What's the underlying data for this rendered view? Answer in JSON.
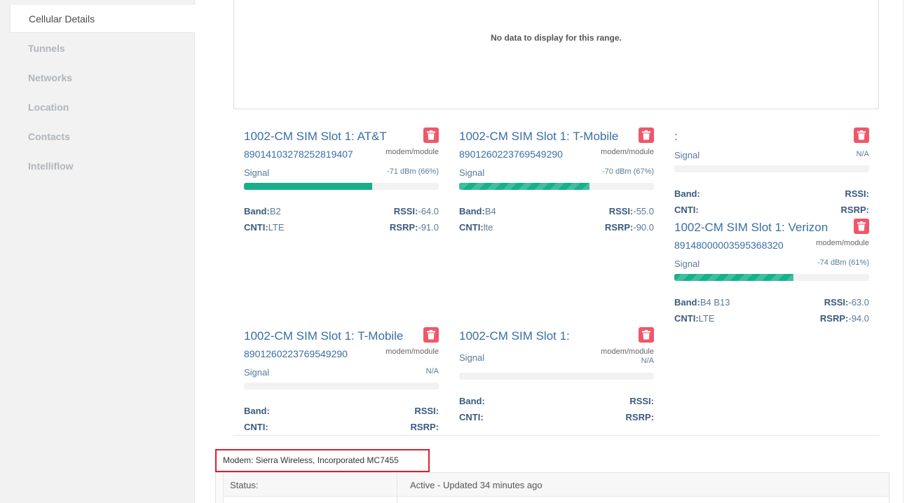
{
  "sidebar": {
    "items": [
      {
        "label": "Cellular Details"
      },
      {
        "label": "Tunnels"
      },
      {
        "label": "Networks"
      },
      {
        "label": "Location"
      },
      {
        "label": "Contacts"
      },
      {
        "label": "Intelliflow"
      }
    ]
  },
  "chart": {
    "empty_message": "No data to display for this range."
  },
  "cards": [
    {
      "title": "1002-CM SIM Slot 1: AT&T",
      "iccid": "89014103278252819407",
      "modem": "modem/module",
      "signal_label": "Signal",
      "signal_value": "-71 dBm (66%)",
      "signal_percent": 66,
      "band_label": "Band:",
      "band": "B2",
      "cnti_label": "CNTI:",
      "cnti": "LTE",
      "rssi_label": "RSSI:",
      "rssi": "-64.0",
      "rsrp_label": "RSRP:",
      "rsrp": "-91.0"
    },
    {
      "title": "1002-CM SIM Slot 1: T-Mobile",
      "iccid": "8901260223769549290",
      "modem": "modem/module",
      "signal_label": "Signal",
      "signal_value": "-70 dBm (67%)",
      "signal_percent": 67,
      "band_label": "Band:",
      "band": "B4",
      "cnti_label": "CNTI:",
      "cnti": "lte",
      "rssi_label": "RSSI:",
      "rssi": "-55.0",
      "rsrp_label": "RSRP:",
      "rsrp": "-90.0"
    },
    {
      "title": ":",
      "iccid": "",
      "modem": "",
      "signal_label": "Signal",
      "signal_value": "N/A",
      "signal_percent": 0,
      "band_label": "Band:",
      "band": "",
      "cnti_label": "CNTI:",
      "cnti": "",
      "rssi_label": "RSSI:",
      "rssi": "",
      "rsrp_label": "RSRP:",
      "rsrp": ""
    },
    {
      "title": "1002-CM SIM Slot 1: Verizon",
      "iccid": "89148000003595368320",
      "modem": "modem/module",
      "signal_label": "Signal",
      "signal_value": "-74 dBm (61%)",
      "signal_percent": 61,
      "band_label": "Band:",
      "band": "B4 B13",
      "cnti_label": "CNTI:",
      "cnti": "LTE",
      "rssi_label": "RSSI:",
      "rssi": "-63.0",
      "rsrp_label": "RSRP:",
      "rsrp": "-94.0"
    },
    {
      "title": "1002-CM SIM Slot 1: T-Mobile",
      "iccid": "8901260223769549290",
      "modem": "modem/module",
      "signal_label": "Signal",
      "signal_value": "N/A",
      "signal_percent": 0,
      "band_label": "Band:",
      "band": "",
      "cnti_label": "CNTI:",
      "cnti": "",
      "rssi_label": "RSSI:",
      "rssi": "",
      "rsrp_label": "RSRP:",
      "rsrp": ""
    },
    {
      "title": "1002-CM SIM Slot 1:",
      "iccid": "",
      "modem": "modem/module",
      "signal_label": "Signal",
      "signal_value": "N/A",
      "signal_percent": 0,
      "band_label": "Band:",
      "band": "",
      "cnti_label": "CNTI:",
      "cnti": "",
      "rssi_label": "RSSI:",
      "rssi": "",
      "rsrp_label": "RSRP:",
      "rsrp": ""
    }
  ],
  "modem_info": {
    "text": "Modem: Sierra Wireless, Incorporated MC7455"
  },
  "status_table": {
    "rows": [
      {
        "key": "Status:",
        "value": "Active - Updated 34 minutes ago"
      }
    ]
  },
  "colors": {
    "accent": "#3a6ea5",
    "signal_bar": "#16b08a",
    "trash": "#f0566a",
    "highlight": "#d9212f"
  }
}
